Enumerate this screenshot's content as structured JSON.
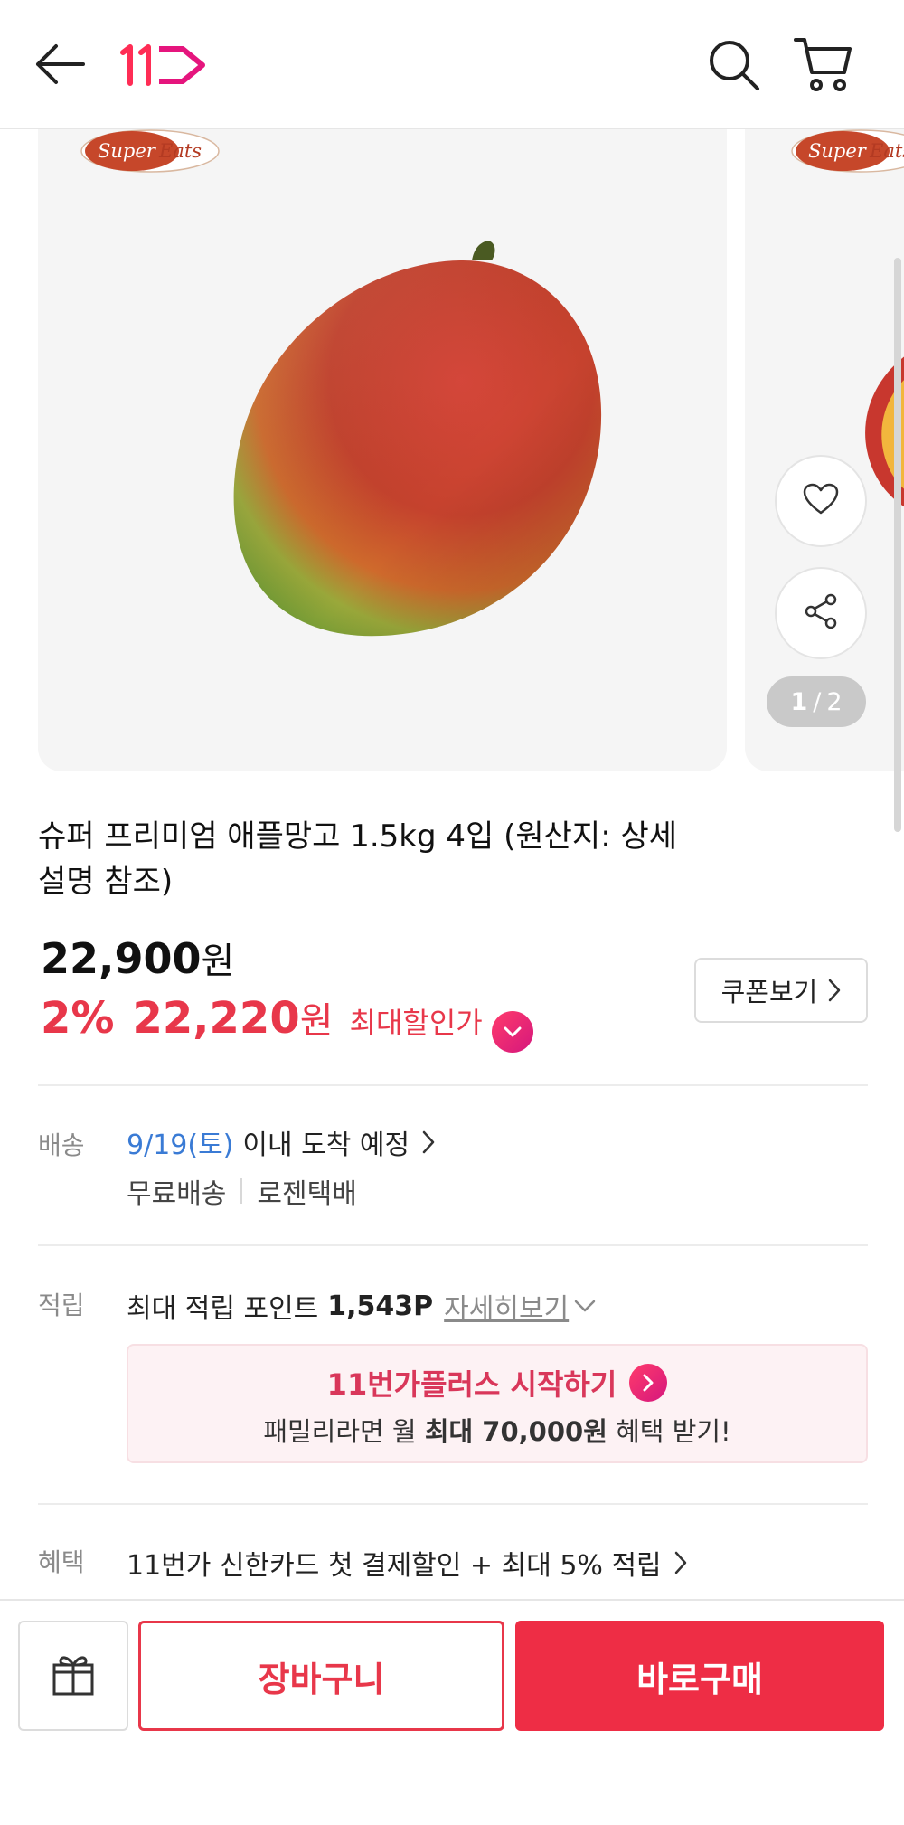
{
  "header": {
    "back_icon": "arrow-left-icon",
    "logo_text": "11",
    "search_icon": "search-icon",
    "cart_icon": "cart-icon"
  },
  "gallery": {
    "brand": "Super Eats",
    "brand_partial": "Super Eat",
    "wishlist_icon": "heart-icon",
    "share_icon": "share-icon",
    "pager": {
      "current": "1",
      "total": "2"
    }
  },
  "product": {
    "title": "슈퍼 프리미엄 애플망고 1.5kg 4입 (원산지: 상세설명 참조)",
    "original_price": "22,900",
    "currency": "원",
    "discount_percent": "2%",
    "sale_price": "22,220",
    "max_discount_label": "최대할인가",
    "coupon_button": "쿠폰보기"
  },
  "delivery": {
    "label": "배송",
    "date": "9/19(토)",
    "eta_text": "이내 도착 예정",
    "shipping_fee": "무료배송",
    "carrier": "로젠택배"
  },
  "points": {
    "label": "적립",
    "text": "최대 적립 포인트",
    "amount": "1,543P",
    "detail_link": "자세히보기"
  },
  "plus_banner": {
    "title": "11번가플러스 시작하기",
    "sub_prefix": "패밀리라면 월",
    "sub_bold": "최대 70,000원",
    "sub_suffix": "혜택 받기!"
  },
  "benefit": {
    "label": "혜택",
    "text": "11번가 신한카드 첫 결제할인 + 최대 5% 적립"
  },
  "bottom_bar": {
    "gift_icon": "gift-icon",
    "cart_label": "장바구니",
    "buy_label": "바로구매"
  },
  "colors": {
    "accent_red": "#e8374a",
    "buy_red": "#ee2d45",
    "link_blue": "#3a7bd5",
    "plus_pink": "#d9375a"
  }
}
